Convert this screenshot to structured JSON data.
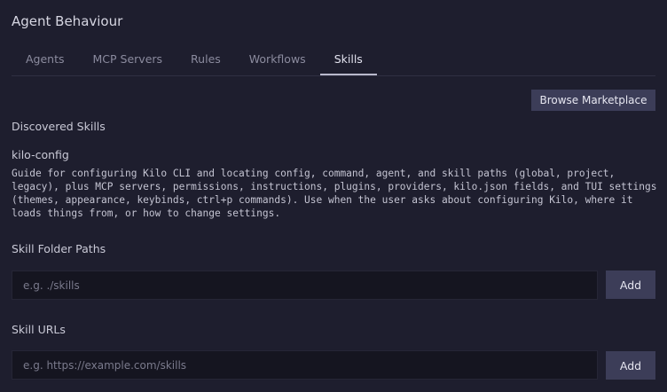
{
  "page": {
    "title": "Agent Behaviour"
  },
  "tabs": [
    {
      "label": "Agents",
      "active": false
    },
    {
      "label": "MCP Servers",
      "active": false
    },
    {
      "label": "Rules",
      "active": false
    },
    {
      "label": "Workflows",
      "active": false
    },
    {
      "label": "Skills",
      "active": true
    }
  ],
  "toolbar": {
    "browse_marketplace_label": "Browse Marketplace"
  },
  "discovered_skills": {
    "heading": "Discovered Skills",
    "items": [
      {
        "name": "kilo-config",
        "description": "Guide for configuring Kilo CLI and locating config, command, agent, and skill paths (global, project, legacy), plus MCP servers, permissions, instructions, plugins, providers, kilo.json fields, and TUI settings (themes, appearance, keybinds, ctrl+p commands). Use when the user asks about configuring Kilo, where it loads things from, or how to change settings."
      }
    ]
  },
  "skill_folder_paths": {
    "heading": "Skill Folder Paths",
    "placeholder": "e.g. ./skills",
    "value": "",
    "add_label": "Add"
  },
  "skill_urls": {
    "heading": "Skill URLs",
    "placeholder": "e.g. https://example.com/skills",
    "value": "",
    "add_label": "Add"
  },
  "colors": {
    "background": "#1e1e2e",
    "button": "#3c3d58",
    "input_background": "#151520",
    "active_tab_underline": "#b9b9cc"
  }
}
